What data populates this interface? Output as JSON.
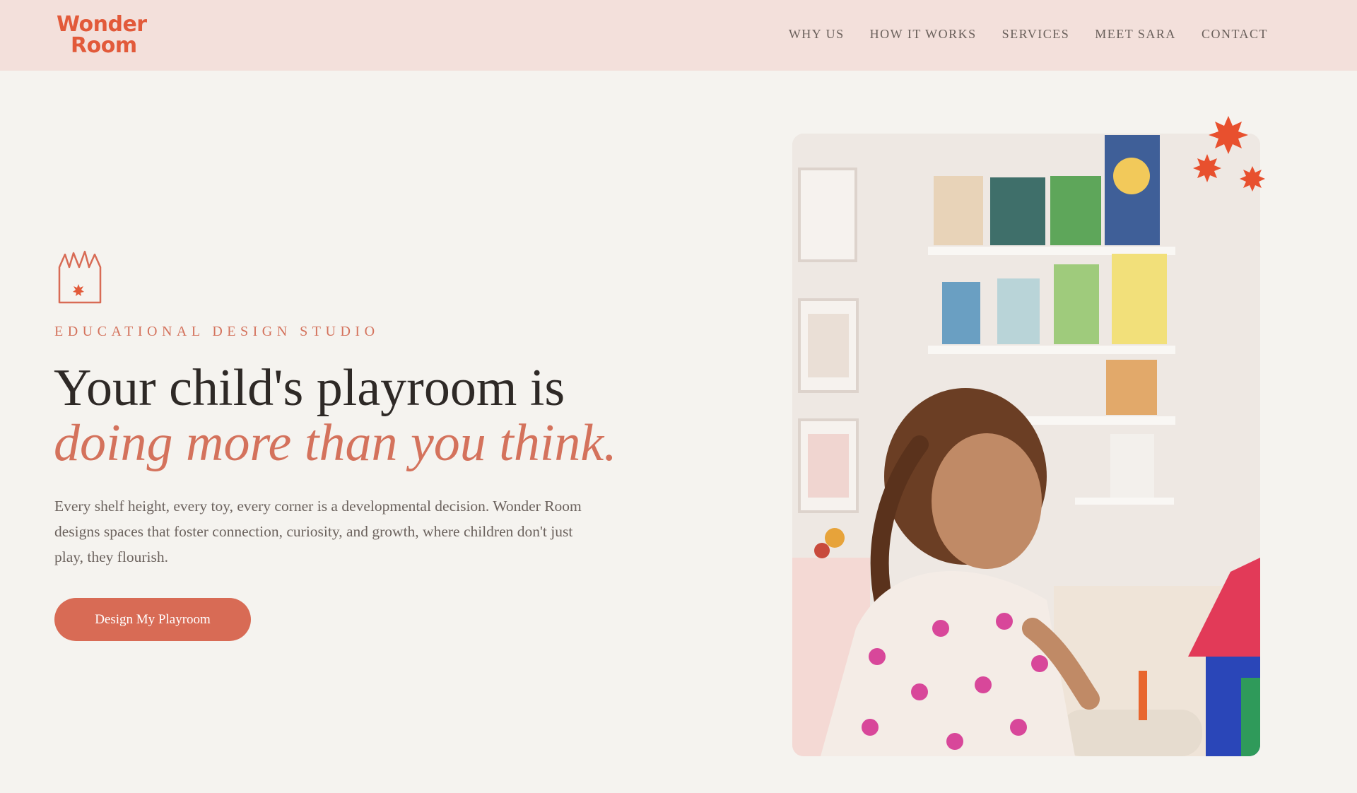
{
  "brand": {
    "logo_line1": "Wonder",
    "logo_line2": "Room"
  },
  "nav": {
    "items": [
      {
        "label": "WHY US"
      },
      {
        "label": "HOW IT WORKS"
      },
      {
        "label": "SERVICES"
      },
      {
        "label": "MEET SARA"
      },
      {
        "label": "CONTACT"
      }
    ]
  },
  "hero": {
    "eyebrow": "EDUCATIONAL DESIGN STUDIO",
    "headline_line1": "Your child's playroom is",
    "headline_line2": "doing more than you think.",
    "body": "Every shelf height, every toy, every corner is a developmental decision. Wonder Room designs spaces that foster connection, curiosity, and growth, where children don't just play, they flourish.",
    "cta_label": "Design My Playroom"
  },
  "colors": {
    "header_bg": "#f3e0db",
    "page_bg": "#f5f3ef",
    "accent": "#d86b55",
    "logo": "#e25a3a",
    "text_dark": "#2e2926"
  }
}
